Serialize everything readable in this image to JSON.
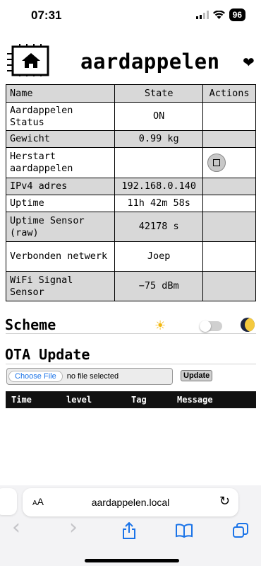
{
  "status_bar": {
    "time": "07:31",
    "battery": "96"
  },
  "header": {
    "title": "aardappelen",
    "heart": "❤"
  },
  "table": {
    "headers": [
      "Name",
      "State",
      "Actions"
    ],
    "rows": [
      {
        "name": "Aardappelen Status",
        "state": "ON"
      },
      {
        "name": "Gewicht",
        "state": "0.99 kg"
      },
      {
        "name": "Herstart aardappelen",
        "state": ""
      },
      {
        "name": "IPv4 adres",
        "state": "192.168.0.140"
      },
      {
        "name": "Uptime",
        "state": "11h 42m 58s"
      },
      {
        "name": "Uptime Sensor (raw)",
        "state": "42178 s"
      },
      {
        "name": "Verbonden netwerk",
        "state": "Joep"
      },
      {
        "name": "WiFi Signal Sensor",
        "state": "−75 dBm"
      }
    ]
  },
  "scheme": {
    "title": "Scheme",
    "sun_icon": "☀",
    "moon_icon": "moon-icon",
    "dark_mode": false
  },
  "ota": {
    "title": "OTA Update",
    "choose_label": "Choose File",
    "file_label": "no file selected",
    "upload_label": "Update"
  },
  "log": {
    "headers": [
      "Time",
      "level",
      "Tag",
      "Message"
    ]
  },
  "browser": {
    "aa_small": "A",
    "aa_large": "A",
    "url": "aardappelen.local",
    "reload_icon": "↻",
    "back_icon": "‹",
    "forward_icon": "›"
  },
  "colors": {
    "accent": "#1a73e8",
    "row_shade": "#d8d8d8",
    "log_header": "#111111"
  }
}
